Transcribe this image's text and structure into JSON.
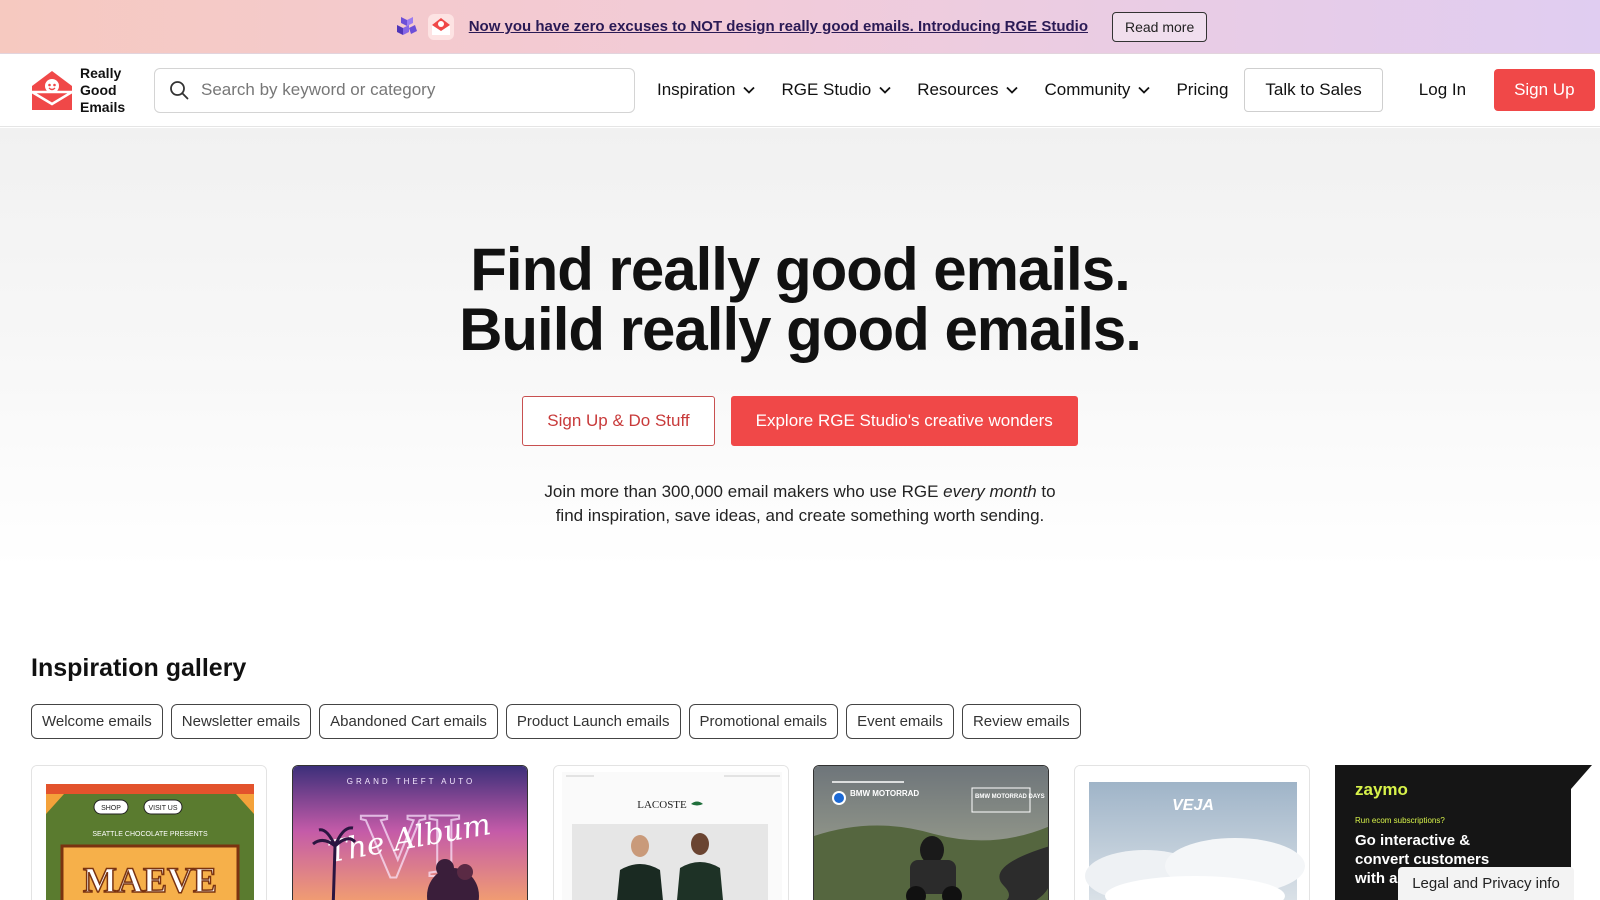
{
  "promo": {
    "text": "Now you have zero excuses to NOT design really good emails. Introducing RGE Studio",
    "button": "Read more"
  },
  "header": {
    "logo_lines": [
      "Really",
      "Good",
      "Emails"
    ],
    "search_placeholder": "Search by keyword or category",
    "nav": [
      {
        "label": "Inspiration"
      },
      {
        "label": "RGE Studio"
      },
      {
        "label": "Resources"
      },
      {
        "label": "Community"
      },
      {
        "label": "Pricing"
      }
    ],
    "talk_to_sales": "Talk to Sales",
    "login": "Log In",
    "signup": "Sign Up"
  },
  "hero": {
    "line1": "Find really good emails.",
    "line2": "Build really good emails.",
    "primary_btn": "Sign Up & Do Stuff",
    "secondary_btn": "Explore RGE Studio's creative wonders",
    "sub_before": "Join more than 300,000 email makers who use RGE ",
    "sub_em": "every month",
    "sub_after": " to",
    "sub_line2": "find inspiration, save ideas, and create something worth sending."
  },
  "gallery": {
    "title": "Inspiration gallery",
    "chips": [
      "Welcome emails",
      "Newsletter emails",
      "Abandoned Cart emails",
      "Product Launch emails",
      "Promotional emails",
      "Event emails",
      "Review emails"
    ],
    "cards": [
      {
        "name": "MAEVE",
        "top_text": "SEATTLE CHOCOLATE PRESENTS",
        "btn1": "SHOP",
        "btn2": "VISIT US"
      },
      {
        "name": "GRAND THEFT AUTO",
        "script": "The Album"
      },
      {
        "name": "LACOSTE"
      },
      {
        "name": "BMW MOTORRAD",
        "badge": "BMW MOTORRAD DAYS"
      },
      {
        "name": "VEJA"
      },
      {
        "name": "zaymo",
        "kicker": "Run ecom subscriptions?",
        "headline": "Go interactive & convert customers with a"
      }
    ]
  },
  "legal": "Legal and Privacy info",
  "colors": {
    "brand_red": "#f04848",
    "promo_link": "#2a1a55"
  }
}
